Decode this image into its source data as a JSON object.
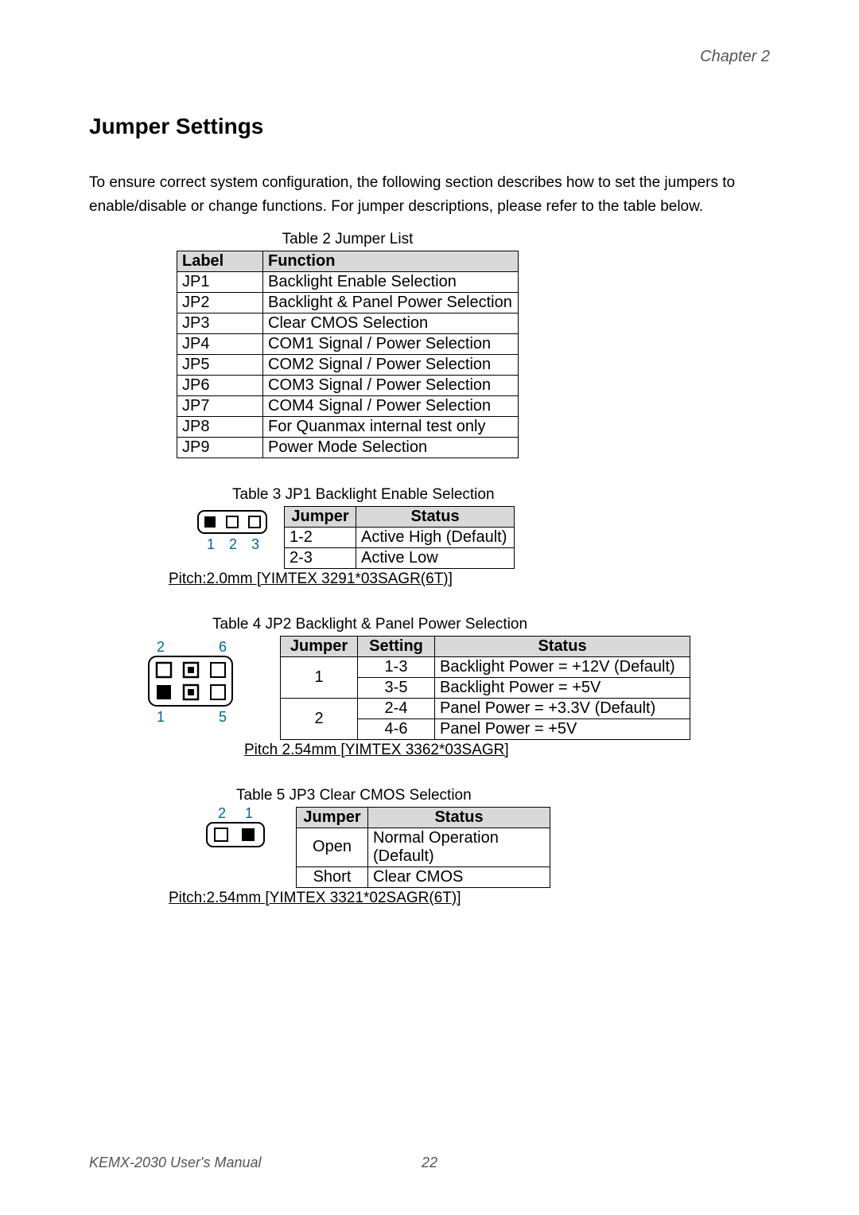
{
  "chapter": "Chapter 2",
  "section_title": "Jumper Settings",
  "intro": "To ensure correct system configuration, the following section describes how to set the jumpers to enable/disable or change functions. For jumper descriptions, please refer to the table below.",
  "table2": {
    "caption": "Table 2 Jumper List",
    "headers": {
      "label": "Label",
      "function": "Function"
    },
    "rows": [
      {
        "label": "JP1",
        "function": "Backlight Enable Selection"
      },
      {
        "label": "JP2",
        "function": "Backlight & Panel Power Selection"
      },
      {
        "label": "JP3",
        "function": "Clear CMOS Selection"
      },
      {
        "label": "JP4",
        "function": "COM1 Signal / Power Selection"
      },
      {
        "label": "JP5",
        "function": "COM2 Signal / Power Selection"
      },
      {
        "label": "JP6",
        "function": "COM3 Signal / Power Selection"
      },
      {
        "label": "JP7",
        "function": "COM4 Signal / Power Selection"
      },
      {
        "label": "JP8",
        "function": "For Quanmax internal test only"
      },
      {
        "label": "JP9",
        "function": "Power Mode Selection"
      }
    ]
  },
  "table3": {
    "caption": "Table 3 JP1   Backlight Enable Selection",
    "headers": {
      "jumper": "Jumper",
      "status": "Status"
    },
    "rows": [
      {
        "jumper": "1-2",
        "status": "Active High (Default)"
      },
      {
        "jumper": "2-3",
        "status": "Active Low"
      }
    ],
    "pitch": "Pitch:2.0mm [YIMTEX 3291*03SAGR(6T)]",
    "diagram_labels": {
      "p1": "1",
      "p2": "2",
      "p3": "3"
    }
  },
  "table4": {
    "caption": "Table 4 JP2   Backlight & Panel Power Selection",
    "headers": {
      "jumper": "Jumper",
      "setting": "Setting",
      "status": "Status"
    },
    "rows": [
      {
        "jumper": "1",
        "setting": "1-3",
        "status": "Backlight Power = +12V (Default)"
      },
      {
        "jumper": "",
        "setting": "3-5",
        "status": "Backlight Power = +5V"
      },
      {
        "jumper": "2",
        "setting": "2-4",
        "status": "Panel Power = +3.3V (Default)"
      },
      {
        "jumper": "",
        "setting": "4-6",
        "status": "Panel Power = +5V"
      }
    ],
    "pitch": "Pitch 2.54mm [YIMTEX 3362*03SAGR]",
    "diagram_labels": {
      "p1": "1",
      "p2": "2",
      "p5": "5",
      "p6": "6"
    }
  },
  "table5": {
    "caption": "Table 5 JP3   Clear CMOS Selection",
    "headers": {
      "jumper": "Jumper",
      "status": "Status"
    },
    "rows": [
      {
        "jumper": "Open",
        "status": "Normal Operation (Default)"
      },
      {
        "jumper": "Short",
        "status": "Clear CMOS"
      }
    ],
    "pitch": "Pitch:2.54mm [YIMTEX 3321*02SAGR(6T)]",
    "diagram_labels": {
      "p1": "1",
      "p2": "2"
    }
  },
  "footer": {
    "manual": "KEMX-2030 User's Manual",
    "page": "22"
  }
}
